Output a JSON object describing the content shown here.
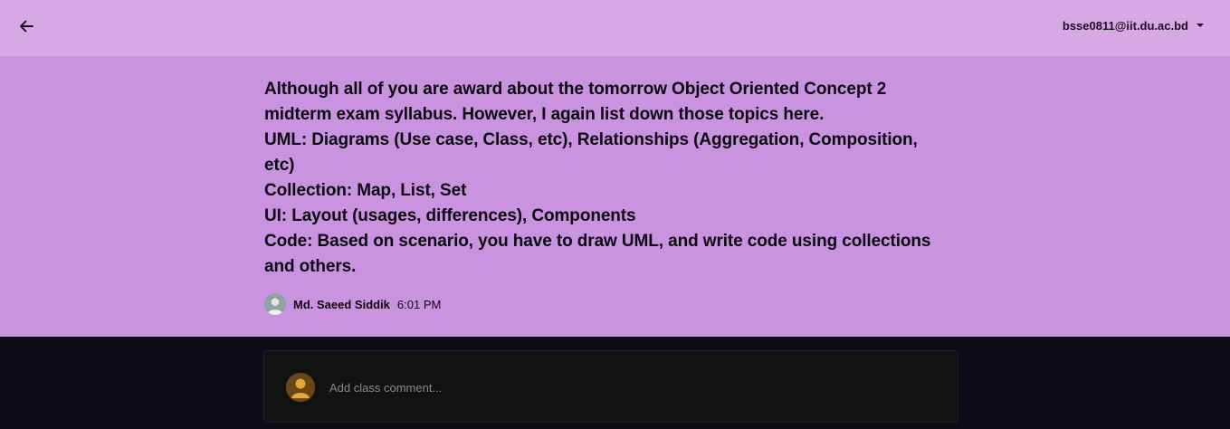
{
  "header": {
    "account_email": "bsse0811@iit.du.ac.bd"
  },
  "announcement": {
    "lines": [
      "Although all of you are award about the tomorrow Object Oriented Concept 2 midterm exam syllabus. However, I again list down those topics here.",
      "UML: Diagrams (Use case, Class, etc), Relationships (Aggregation, Composition, etc)",
      "Collection: Map, List, Set",
      "UI: Layout (usages, differences), Components",
      "Code: Based on scenario, you have to draw UML, and write code using collections and others."
    ],
    "author": "Md. Saeed Siddik",
    "time": "6:01 PM"
  },
  "comment": {
    "placeholder": "Add class comment..."
  },
  "icons": {
    "back": "arrow-left-icon",
    "account_menu": "caret-down-icon",
    "author_avatar": "avatar",
    "commenter_avatar": "person-icon"
  },
  "colors": {
    "header_bg": "#d6a8e6",
    "panel_bg": "#c993e0",
    "page_bg": "#0f0a17",
    "comment_box_bg": "#121212",
    "commenter_avatar_bg": "#6b4513",
    "commenter_avatar_fg": "#e0a93a"
  }
}
